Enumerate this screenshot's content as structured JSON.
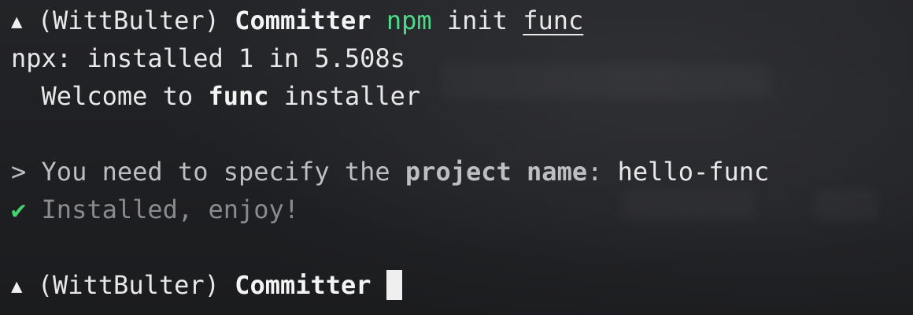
{
  "prompt": {
    "arrow": "▲",
    "env": "(WittBulter)",
    "dir": "Committer"
  },
  "lines": {
    "command": {
      "cmd": "npm",
      "args": "init",
      "pkg": "func"
    },
    "npx_output": "npx: installed 1 in 5.508s",
    "welcome_prefix": "  Welcome to ",
    "welcome_bold": "func",
    "welcome_suffix": " installer",
    "question_marker": ">",
    "question_text": "You need to specify the",
    "question_bold": "project name",
    "question_colon": ":",
    "question_answer": "hello-func",
    "success_icon": "✔",
    "success_text": "Installed, enjoy!"
  },
  "colors": {
    "green": "#4ddb8a",
    "check": "#45d36f",
    "muted": "#8a8b8d",
    "background": "#1d1f21"
  }
}
